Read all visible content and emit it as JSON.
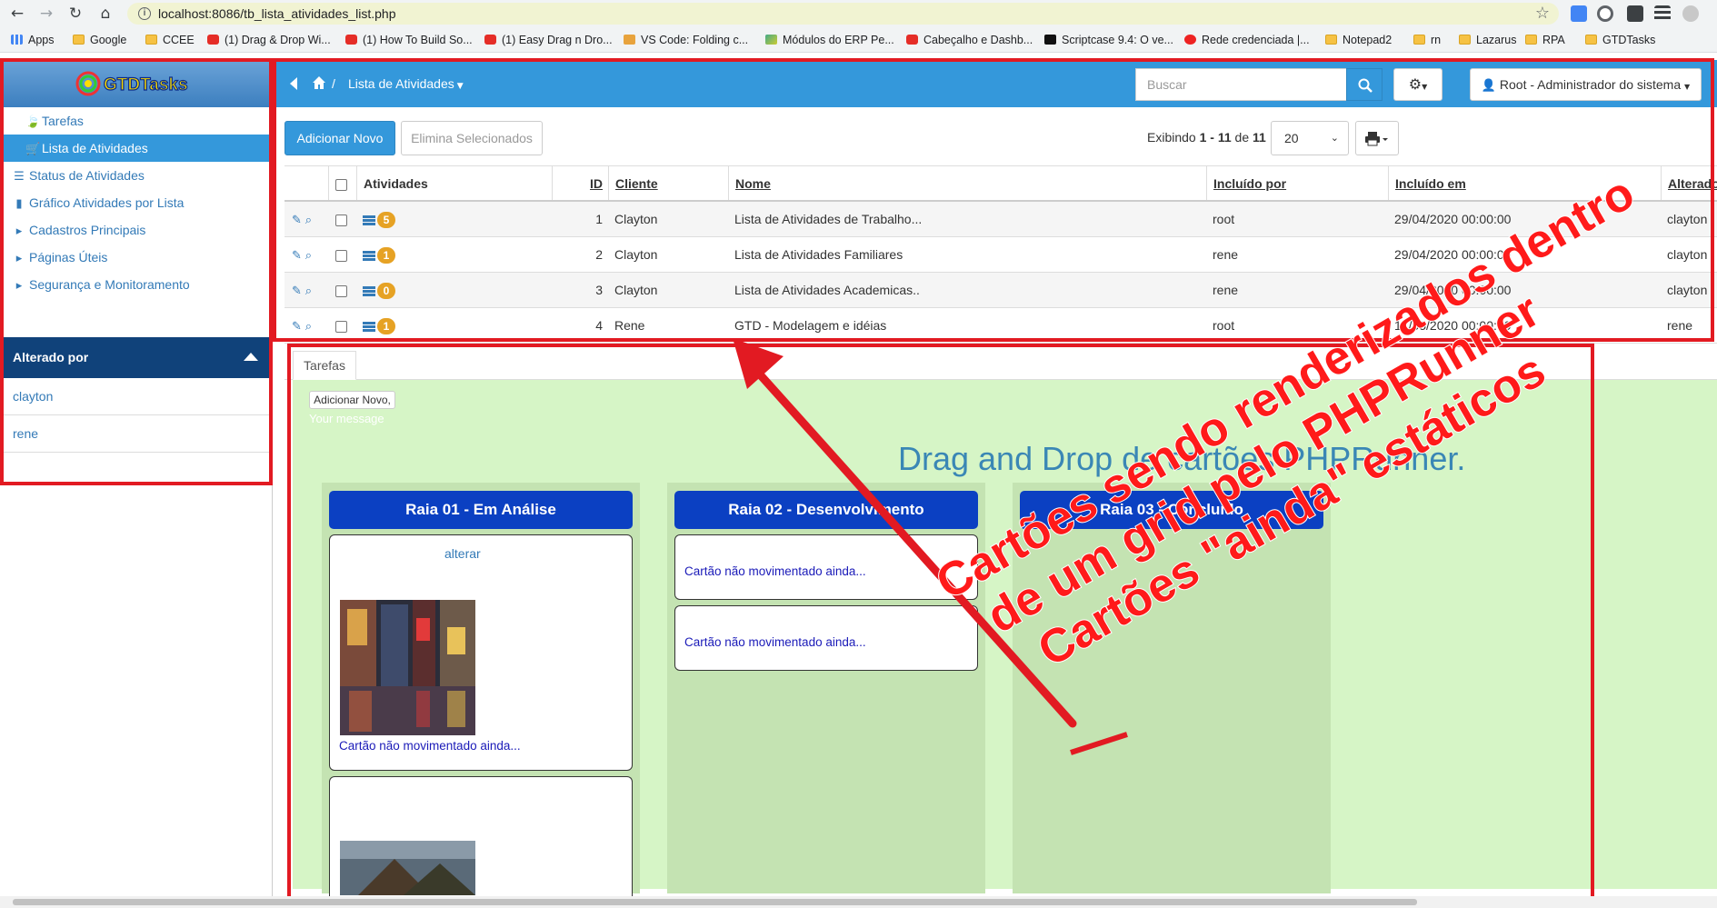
{
  "browser": {
    "url": "localhost:8086/tb_lista_atividades_list.php",
    "bookmarks": [
      {
        "label": "Apps",
        "icon": "apps-icon"
      },
      {
        "label": "Google",
        "icon": "folder-icon"
      },
      {
        "label": "CCEE",
        "icon": "folder-icon"
      },
      {
        "label": "(1) Drag & Drop Wi...",
        "icon": "youtube-icon"
      },
      {
        "label": "(1) How To Build So...",
        "icon": "youtube-icon"
      },
      {
        "label": "(1) Easy Drag n Dro...",
        "icon": "youtube-icon"
      },
      {
        "label": "VS Code: Folding c...",
        "icon": "vscode-icon"
      },
      {
        "label": "Módulos do ERP Pe...",
        "icon": "map-icon"
      },
      {
        "label": "Cabeçalho e Dashb...",
        "icon": "youtube-icon"
      },
      {
        "label": "Scriptcase 9.4: O ve...",
        "icon": "scriptcase-icon"
      },
      {
        "label": "Rede credenciada |...",
        "icon": "rede-icon"
      },
      {
        "label": "Notepad2",
        "icon": "folder-icon"
      },
      {
        "label": "rn",
        "icon": "folder-icon"
      },
      {
        "label": "Lazarus",
        "icon": "folder-icon"
      },
      {
        "label": "RPA",
        "icon": "folder-icon"
      },
      {
        "label": "GTDTasks",
        "icon": "folder-icon"
      }
    ]
  },
  "app": {
    "logo_text": "GTDTasks",
    "colors": {
      "primary": "#3498db",
      "sidebar_head": "#10427a",
      "lane_head": "#0b40c2",
      "badge": "#e6a224",
      "kanban_bg": "#d6f5c6",
      "annotation": "#e21a22"
    }
  },
  "sidebar": {
    "items": [
      {
        "label": "Tarefas",
        "icon": "leaf-icon"
      },
      {
        "label": "Lista de Atividades",
        "icon": "cart-icon"
      },
      {
        "label": "Status de Atividades",
        "icon": "list-icon"
      },
      {
        "label": "Gráfico Atividades por Lista",
        "icon": "bar-chart-icon"
      },
      {
        "label": "Cadastros Principais",
        "icon": "caret-right-icon"
      },
      {
        "label": "Páginas Úteis",
        "icon": "caret-right-icon"
      },
      {
        "label": "Segurança e Monitoramento",
        "icon": "caret-right-icon"
      }
    ],
    "filter": {
      "title": "Alterado por",
      "values": [
        "clayton",
        "rene"
      ]
    }
  },
  "topbar": {
    "breadcrumb_sep": "/",
    "page_title": "Lista de Atividades",
    "search_placeholder": "Buscar",
    "user_label": "Root - Administrador do sistema"
  },
  "toolbar": {
    "add_label": "Adicionar Novo",
    "delete_label": "Elimina Selecionados",
    "paging_prefix": "Exibindo",
    "paging_from": "1",
    "paging_sep": "-",
    "paging_to": "11",
    "paging_of": "de",
    "paging_total": "11",
    "page_size": "20"
  },
  "grid": {
    "columns": [
      "Atividades",
      "ID",
      "Cliente",
      "Nome",
      "Incluído por",
      "Incluído em",
      "Alterado por"
    ],
    "rows": [
      {
        "badge": "5",
        "id": "1",
        "cliente": "Clayton",
        "nome": "Lista de Atividades de Trabalho...",
        "incluido_por": "root",
        "incluido_em": "29/04/2020 00:00:00",
        "alterado_por": "clayton"
      },
      {
        "badge": "1",
        "id": "2",
        "cliente": "Clayton",
        "nome": "Lista de Atividades Familiares",
        "incluido_por": "rene",
        "incluido_em": "29/04/2020 00:00:00",
        "alterado_por": "clayton"
      },
      {
        "badge": "0",
        "id": "3",
        "cliente": "Clayton",
        "nome": "Lista de Atividades Academicas..",
        "incluido_por": "rene",
        "incluido_em": "29/04/2020 00:00:00",
        "alterado_por": "clayton"
      },
      {
        "badge": "1",
        "id": "4",
        "cliente": "Rene",
        "nome": "GTD - Modelagem e idéias",
        "incluido_por": "root",
        "incluido_em": "17/05/2020 00:00:00",
        "alterado_por": "rene"
      }
    ]
  },
  "detail": {
    "tab_label": "Tarefas",
    "add_button": "Adicionar Novo,",
    "message": "Your message",
    "title": "Drag and Drop de cartões PHPRunner.",
    "lanes": [
      {
        "title": "Raia 01 - Em Análise"
      },
      {
        "title": "Raia 02 - Desenvolvimento"
      },
      {
        "title": "Raia 03 - Concluído"
      }
    ],
    "card_link": "alterar",
    "card_text": "Cartão não movimentado ainda..."
  },
  "annotation": {
    "line1": "Cartões sendo renderizados dentro",
    "line2": "de um grid pelo PHPRunner",
    "line3": "Cartões \"ainda\" estáticos"
  }
}
